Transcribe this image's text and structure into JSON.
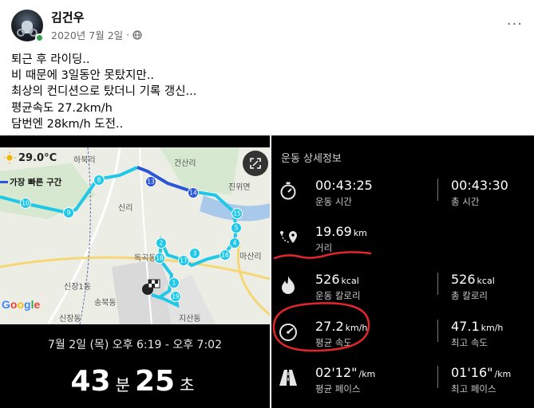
{
  "post": {
    "author": "김건우",
    "date": "2020년 7월 2일",
    "more": "···",
    "lines": [
      "퇴근 후 라이딩..",
      "비 때문에 3일동안 못탔지만..",
      "최상의 컨디션으로 탔더니 기록 갱신...",
      "평균속도 27.2km/h",
      "담번엔 28km/h 도전.."
    ]
  },
  "map": {
    "temperature": "29.0°C",
    "fastest_route": "가장 빠른 구간",
    "google": "Google",
    "places": [
      "하북리",
      "건산리",
      "진위면",
      "신리",
      "마산리",
      "독곡동",
      "신장1동",
      "송북동",
      "지산동",
      "신장동"
    ],
    "waypoints": [
      "13",
      "14",
      "5",
      "15",
      "4",
      "16",
      "17",
      "3",
      "2",
      "18",
      "1",
      "19",
      "8",
      "9",
      "10"
    ],
    "date_range": "7월 2일 (목) 오후 6:19 - 오후 7:02",
    "duration": {
      "minutes": "43",
      "min_unit": "분",
      "seconds": "25",
      "sec_unit": "초"
    }
  },
  "details": {
    "title": "운동 상세정보",
    "rows": [
      {
        "icon": "stopwatch-icon",
        "left_value": "00:43:25",
        "left_unit": "",
        "left_label": "운동 시간",
        "right_value": "00:43:30",
        "right_unit": "",
        "right_label": "총 시간"
      },
      {
        "icon": "route-icon",
        "left_value": "19.69",
        "left_unit": "km",
        "left_label": "거리",
        "right_value": "",
        "right_unit": "",
        "right_label": ""
      },
      {
        "icon": "flame-icon",
        "left_value": "526",
        "left_unit": "kcal",
        "left_label": "운동 칼로리",
        "right_value": "526",
        "right_unit": "kcal",
        "right_label": "총 칼로리"
      },
      {
        "icon": "speedometer-icon",
        "left_value": "27.2",
        "left_unit": "km/h",
        "left_label": "평균 속도",
        "right_value": "47.1",
        "right_unit": "km/h",
        "right_label": "최고 속도"
      },
      {
        "icon": "road-icon",
        "left_value": "02'12\"",
        "left_unit": "/km",
        "left_label": "평균 페이스",
        "right_value": "01'16\"",
        "right_unit": "/km",
        "right_label": "최고 페이스"
      }
    ]
  },
  "colors": {
    "route": "#1ec8e6",
    "route_fast": "#2a55d6",
    "highlight": "#e3262b",
    "online": "#31a24c"
  }
}
